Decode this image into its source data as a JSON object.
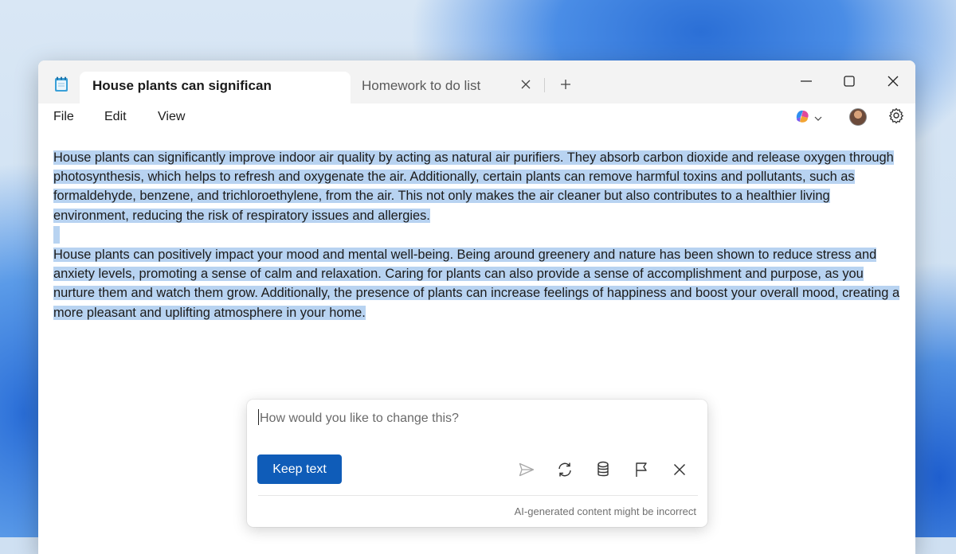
{
  "window": {
    "active_tab_title": "House plants can significan",
    "inactive_tab_title": "Homework to do list",
    "icons": {
      "app": "notepad-icon",
      "tab_close": "close-icon",
      "new_tab": "plus-icon",
      "minimize": "minimize-icon",
      "maximize": "maximize-icon",
      "close": "close-icon"
    }
  },
  "menubar": {
    "items": [
      {
        "label": "File"
      },
      {
        "label": "Edit"
      },
      {
        "label": "View"
      }
    ],
    "right_icons": [
      "copilot-icon",
      "chevron-down-icon",
      "avatar",
      "gear-icon"
    ]
  },
  "document": {
    "paragraph1": "House plants can significantly improve indoor air quality by acting as natural air purifiers. They absorb carbon dioxide and release oxygen through photosynthesis, which helps to refresh and oxygenate the air. Additionally, certain plants can remove harmful toxins and pollutants, such as formaldehyde, benzene, and trichloroethylene, from the air. This not only makes the air cleaner but also contributes to a healthier living environment, reducing the risk of respiratory issues and allergies.",
    "paragraph2": "House plants can positively impact your mood and mental well-being. Being around greenery and nature has been shown to reduce stress and anxiety levels, promoting a sense of calm and relaxation. Caring for plants can also provide a sense of accomplishment and purpose, as you nurture them and watch them grow. Additionally, the presence of plants can increase feelings of happiness and boost your overall mood, creating a more pleasant and uplifting atmosphere in your home.",
    "selection_color": "#b8d3f1"
  },
  "rewrite": {
    "placeholder": "How would you like to change this?",
    "keep_label": "Keep text",
    "disclaimer": "AI-generated content might be incorrect",
    "accent": "#0f5cb8",
    "icons": [
      "send-icon",
      "retry-icon",
      "stack-icon",
      "flag-icon",
      "close-icon"
    ]
  }
}
